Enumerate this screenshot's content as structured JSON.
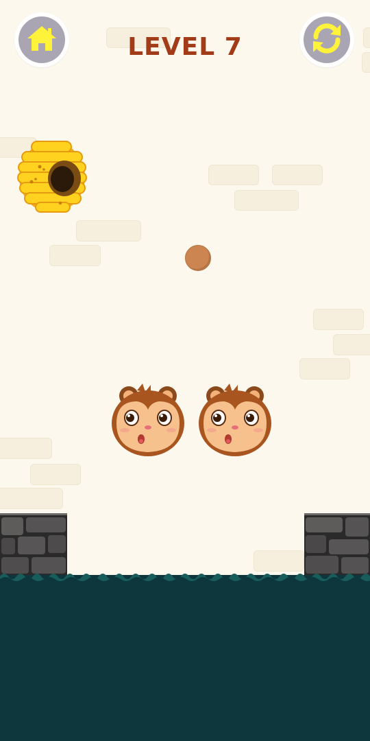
{
  "header": {
    "level_label": "LEVEL 7"
  },
  "buttons": {
    "home_icon": "home-icon",
    "restart_icon": "restart-icon"
  },
  "colors": {
    "background": "#fcf8ee",
    "level_text": "#a23b18",
    "button_fill": "#a9a5b3",
    "icon_yellow": "#fff23a",
    "water": "#0e363d",
    "ball": "#cc8450"
  },
  "scene": {
    "characters": [
      "monkey",
      "monkey"
    ],
    "objects": [
      "beehive",
      "ball",
      "stone-wall-left",
      "stone-wall-right",
      "water"
    ]
  }
}
